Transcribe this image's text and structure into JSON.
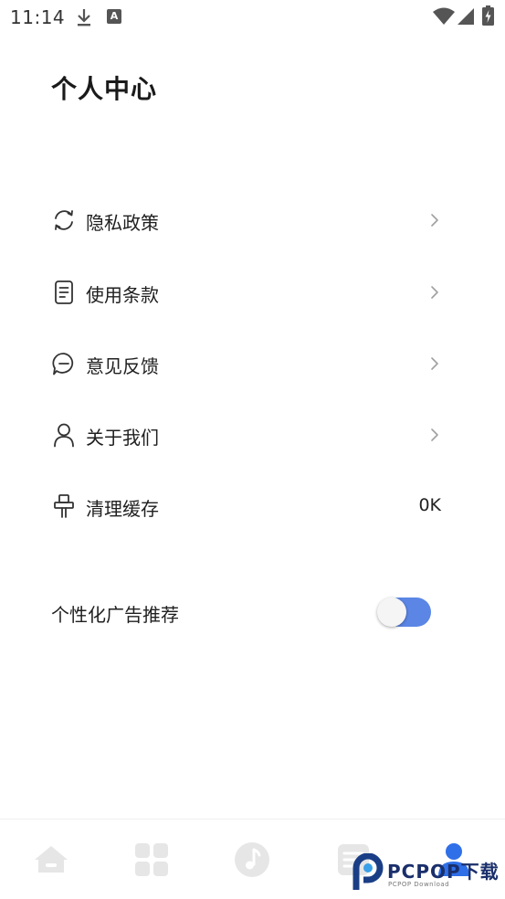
{
  "status_bar": {
    "time": "11:14",
    "notification_letter": "A"
  },
  "page": {
    "title": "个人中心"
  },
  "menu": {
    "privacy": {
      "label": "隐私政策",
      "icon": "refresh-icon"
    },
    "terms": {
      "label": "使用条款",
      "icon": "document-icon"
    },
    "feedback": {
      "label": "意见反馈",
      "icon": "chat-icon"
    },
    "about": {
      "label": "关于我们",
      "icon": "person-icon"
    },
    "cache": {
      "label": "清理缓存",
      "icon": "broom-icon",
      "value": "0K"
    }
  },
  "ad_setting": {
    "label": "个性化广告推荐",
    "enabled": true
  },
  "bottom_nav": {
    "items": [
      {
        "icon": "home-icon"
      },
      {
        "icon": "grid-icon"
      },
      {
        "icon": "music-icon"
      },
      {
        "icon": "list-icon"
      },
      {
        "icon": "user-icon",
        "active": true
      }
    ]
  },
  "watermark": {
    "text": "PCPOP下载",
    "sub": "PCPOP Download"
  },
  "colors": {
    "accent": "#5b86e5",
    "nav_inactive": "#e6e6e6",
    "nav_active": "#2f6fe8",
    "icon_stroke": "#333333"
  }
}
